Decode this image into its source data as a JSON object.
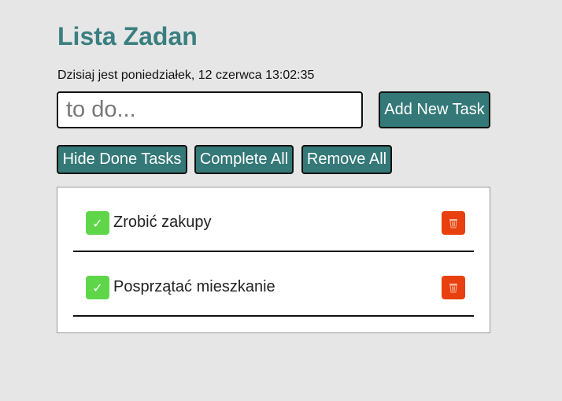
{
  "header": {
    "title": "Lista Zadan",
    "date_line": "Dzisiaj jest poniedziałek, 12 czerwca 13:02:35"
  },
  "form": {
    "input_value": "",
    "input_placeholder": "to do...",
    "add_label": "Add New Task"
  },
  "controls": {
    "hide_done_label": "Hide Done Tasks",
    "complete_all_label": "Complete All",
    "remove_all_label": "Remove All"
  },
  "tasks": [
    {
      "text": "Zrobić zakupy",
      "check_icon": "✓",
      "done": false
    },
    {
      "text": "Posprzątać mieszkanie",
      "check_icon": "✓",
      "done": false
    }
  ],
  "icons": {
    "check": "check-icon",
    "delete": "trash-icon"
  },
  "colors": {
    "accent": "#3a7f80",
    "button_bg": "#347878",
    "check_bg": "#5fd64a",
    "delete_bg": "#e8400f",
    "page_bg": "#e6e6e6"
  }
}
